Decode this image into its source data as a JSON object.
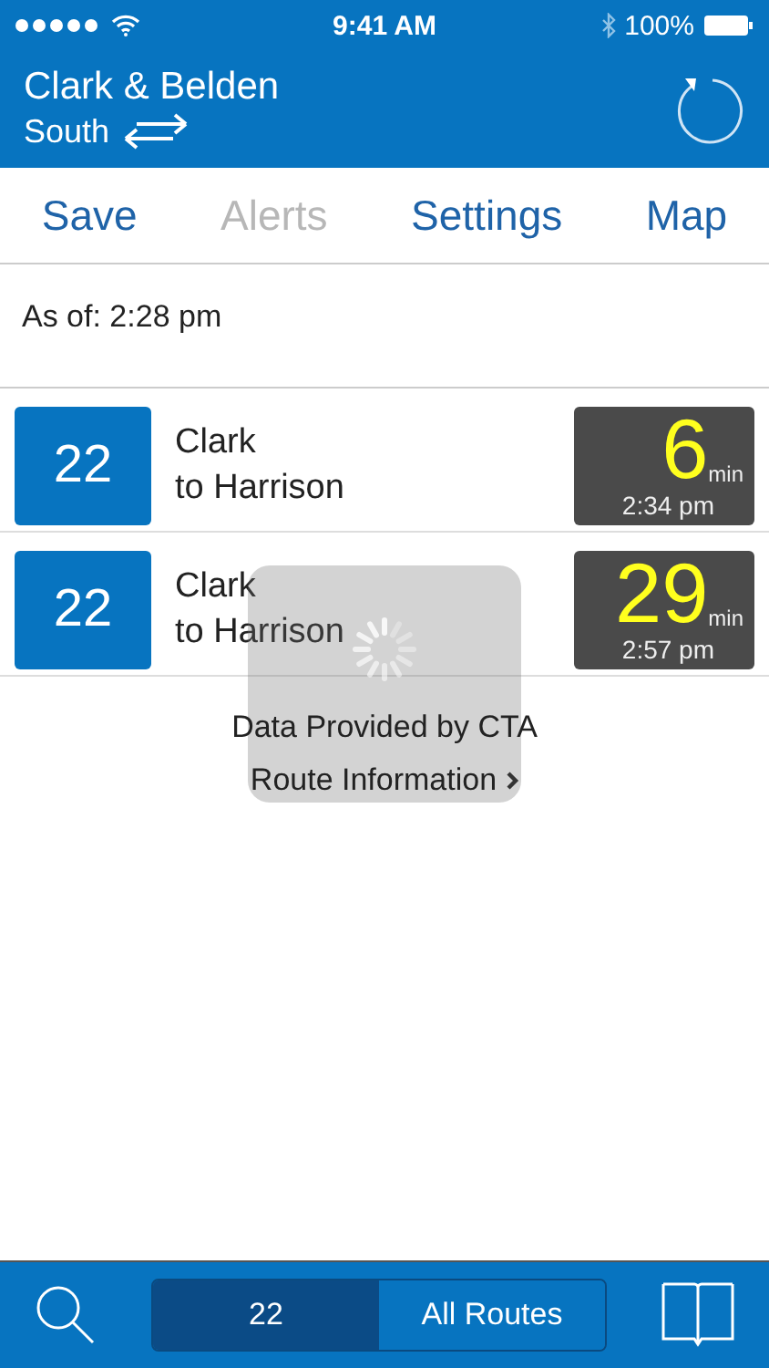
{
  "status_bar": {
    "time": "9:41 AM",
    "battery": "100%"
  },
  "header": {
    "stop": "Clark & Belden",
    "direction": "South"
  },
  "tabs": [
    {
      "label": "Save",
      "disabled": false
    },
    {
      "label": "Alerts",
      "disabled": true
    },
    {
      "label": "Settings",
      "disabled": false
    },
    {
      "label": "Map",
      "disabled": false
    }
  ],
  "as_of": "As of: 2:28 pm",
  "arrivals": [
    {
      "route": "22",
      "street": "Clark",
      "destination": "to Harrison",
      "minutes": "6",
      "unit": "min",
      "time": "2:34 pm"
    },
    {
      "route": "22",
      "street": "Clark",
      "destination": "to Harrison",
      "minutes": "29",
      "unit": "min",
      "time": "2:57 pm"
    }
  ],
  "credit": "Data Provided by CTA",
  "route_info": "Route Information",
  "loading": {
    "kind": "spinner"
  },
  "segments": [
    {
      "label": "22",
      "selected": true
    },
    {
      "label": "All Routes",
      "selected": false
    }
  ]
}
